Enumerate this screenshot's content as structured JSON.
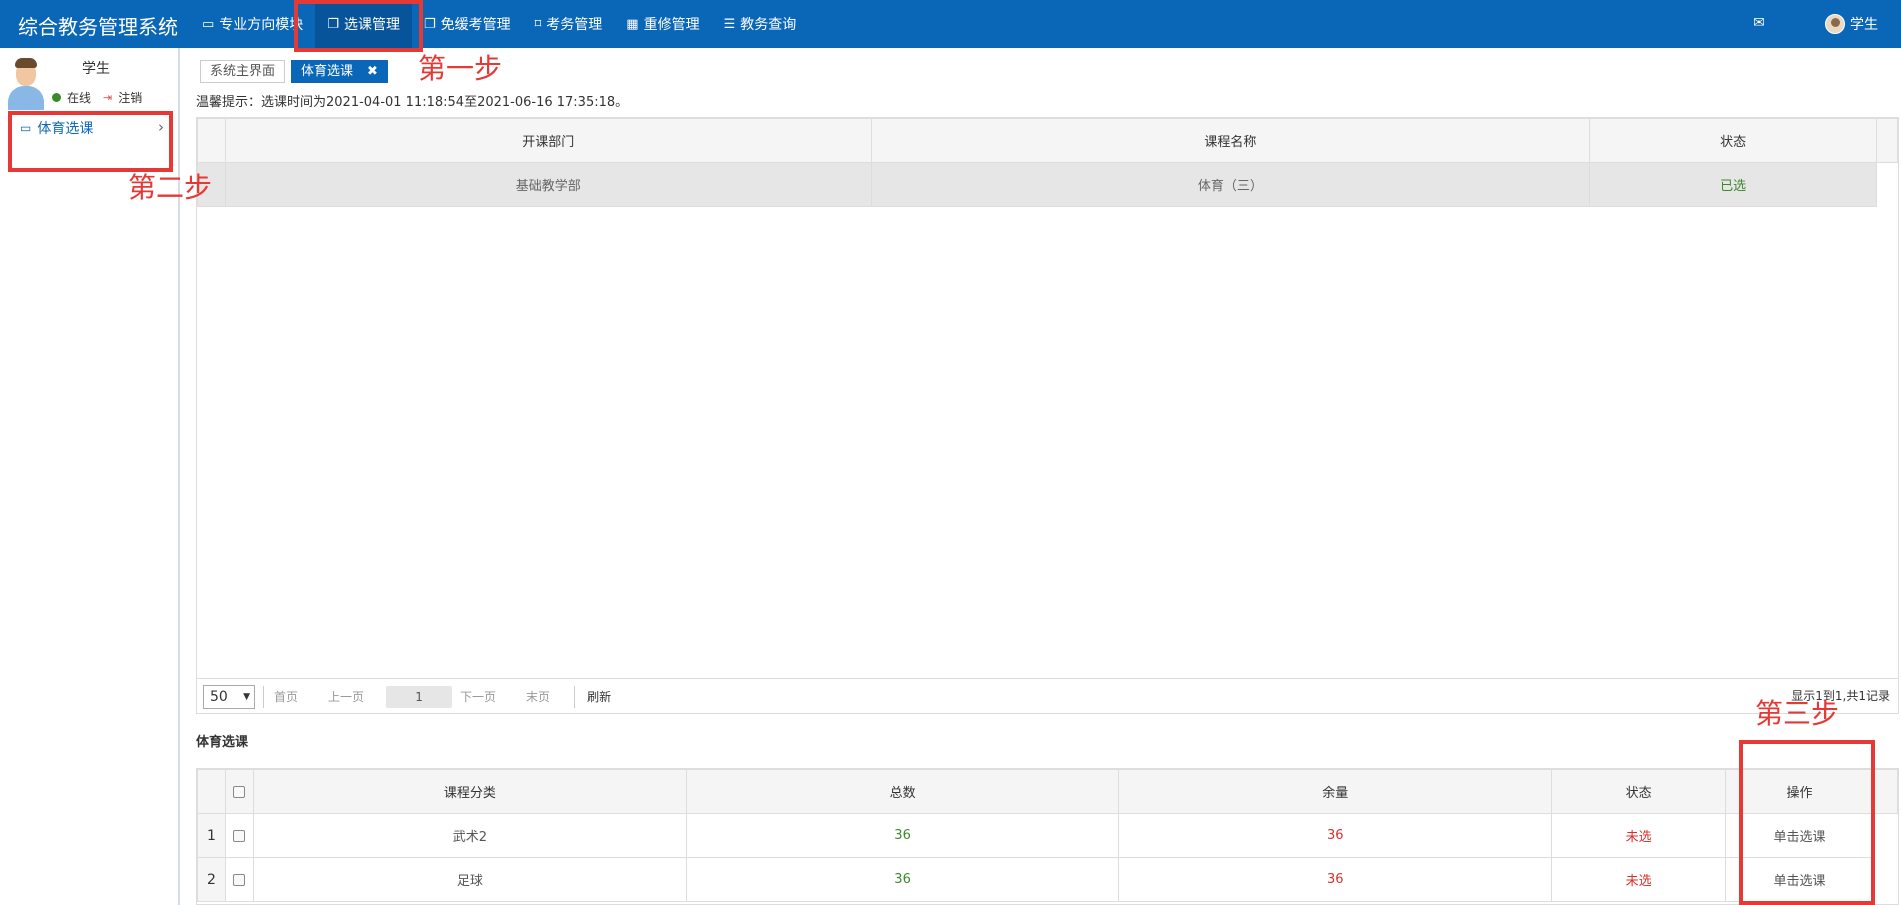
{
  "header": {
    "brand": "综合教务管理系统",
    "nav": [
      {
        "label": "专业方向模块",
        "icon": "monitor-icon"
      },
      {
        "label": "选课管理",
        "icon": "copy-icon"
      },
      {
        "label": "免缓考管理",
        "icon": "copy-icon"
      },
      {
        "label": "考务管理",
        "icon": "bookmark-icon"
      },
      {
        "label": "重修管理",
        "icon": "calendar-icon"
      },
      {
        "label": "教务查询",
        "icon": "list-icon"
      }
    ],
    "user": "学生"
  },
  "sidebar": {
    "name": "学生",
    "online": "在线",
    "logout": "注销",
    "item": "体育选课"
  },
  "annotations": {
    "step1": "第一步",
    "step2": "第二步",
    "step3": "第三步"
  },
  "tabs": {
    "home": "系统主界面",
    "current": "体育选课"
  },
  "hint": "温馨提示：选课时间为2021-04-01 11:18:54至2021-06-16 17:35:18。",
  "selected_table": {
    "headers": [
      "开课部门",
      "课程名称",
      "状态"
    ],
    "rows": [
      [
        "基础教学部",
        "体育（三）",
        "已选"
      ]
    ]
  },
  "pager": {
    "page_size": "50",
    "first": "首页",
    "prev": "上一页",
    "page": "1",
    "next": "下一页",
    "last": "末页",
    "refresh": "刷新",
    "info": "显示1到1,共1记录"
  },
  "section_title": "体育选课",
  "course_table": {
    "headers": [
      "课程分类",
      "总数",
      "余量",
      "状态",
      "操作"
    ],
    "rows": [
      {
        "num": "1",
        "category": "武术2",
        "total": "36",
        "remain": "36",
        "status": "未选",
        "action": "单击选课"
      },
      {
        "num": "2",
        "category": "足球",
        "total": "36",
        "remain": "36",
        "status": "未选",
        "action": "单击选课"
      }
    ]
  },
  "colors": {
    "header_bg": "#0a67b8",
    "annotation": "#e53935",
    "ok": "#3b8a2a",
    "warn": "#d9302c"
  }
}
